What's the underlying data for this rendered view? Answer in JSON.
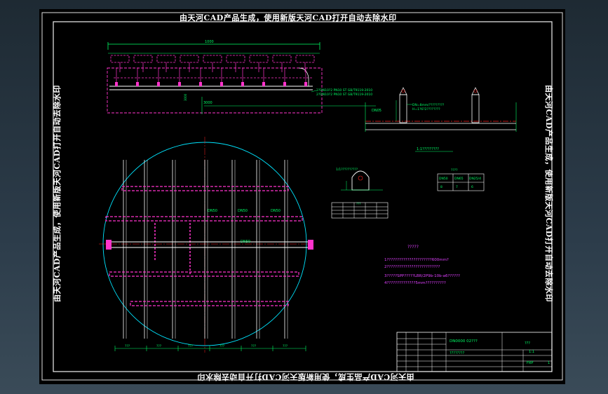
{
  "watermark": {
    "top": "由天河CAD产品生成，使用新版天河CAD打开自动去除水印",
    "bottom": "由天河CAD产品生成，使用新版天河CAD打开自动去除水印",
    "left": "由天河CAD产品生成，使用新版天河CAD打开自动去除水印",
    "right": "由天河CAD产品生成，使用新版天河CAD打开自动去除水印"
  },
  "elevation": {
    "dims": [
      "1000",
      "3000"
    ],
    "notes": [
      "2?DN10?2 PN10 ST GB/T9119-2010",
      "2?DN10?2 PN10 ST GB/T9119-2010"
    ]
  },
  "detail": {
    "labels": [
      "DN05",
      "??",
      "??"
    ],
    "caption": "1:1?????????",
    "pipe_note": "DN=8mm/?????????",
    "pipe_note2": "H=1?6?2????????"
  },
  "plan": {
    "pipe_labels": [
      "DN50",
      "DN50",
      "DN50",
      "DN50"
    ],
    "bottom_dims": [
      "???",
      "???",
      "???",
      "???",
      "???",
      "???"
    ]
  },
  "section": {
    "caption": "1/1??????????",
    "small_table": {
      "title": "????",
      "headers": [
        "DN50",
        "DN65",
        "DN25/4"
      ],
      "values": [
        "8",
        "7",
        "6"
      ]
    },
    "detail_table_title": "???"
  },
  "notes": {
    "title": "?????",
    "lines": [
      "1??????????????????????600mm?",
      "2??????????????????????????",
      "3?????SPP?????LBR/2P9b-10b-a6??????",
      "4??????????????5mm??????????"
    ]
  },
  "title_block": {
    "project": "DN0000 02???",
    "sub": "????????",
    "sheet": "???",
    "scale": "1:1",
    "code": "FRP",
    "page": "1"
  }
}
